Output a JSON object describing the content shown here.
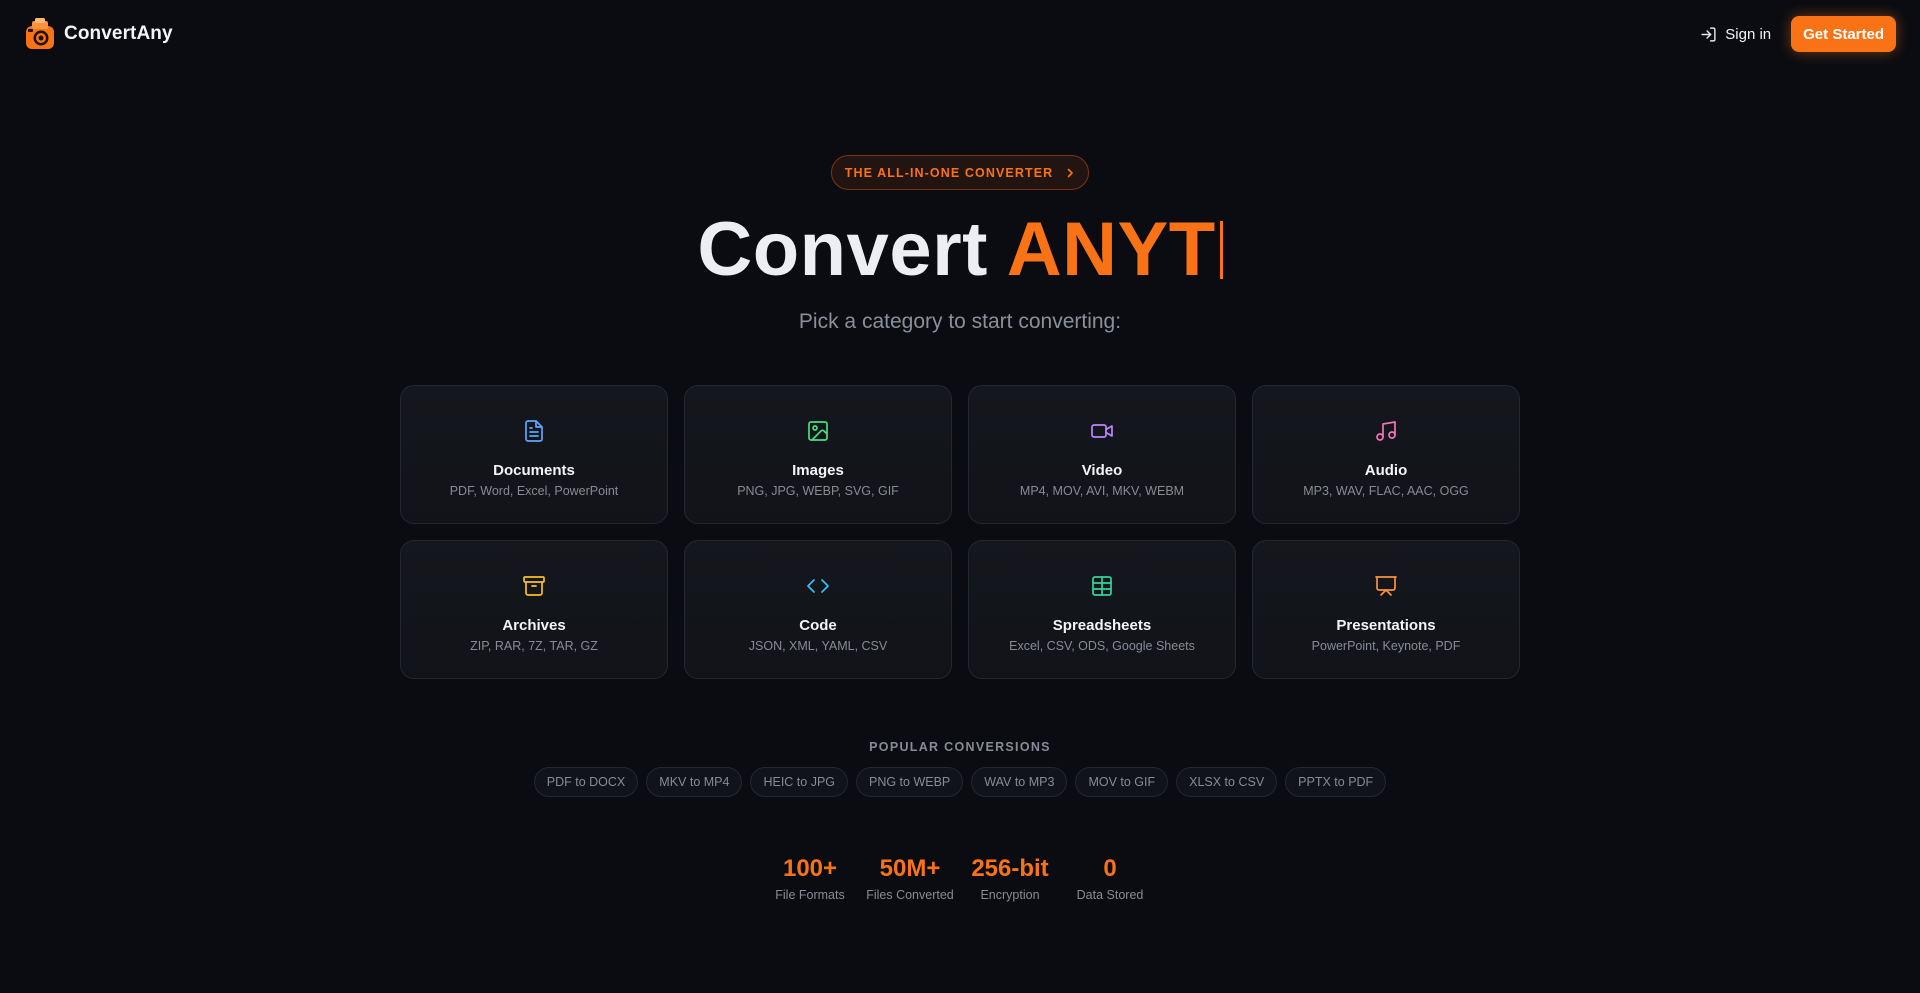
{
  "header": {
    "brand_name": "ConvertAny",
    "signin_label": "Sign in",
    "get_started_label": "Get Started"
  },
  "hero": {
    "pill_text": "THE ALL-IN-ONE CONVERTER",
    "title_prefix": "Convert",
    "title_accent": "ANYT",
    "subtitle": "Pick a category to start converting:"
  },
  "categories": [
    {
      "title": "Documents",
      "desc": "PDF, Word, Excel, PowerPoint",
      "icon": "document-icon",
      "color": "#60a5fa"
    },
    {
      "title": "Images",
      "desc": "PNG, JPG, WEBP, SVG, GIF",
      "icon": "image-icon",
      "color": "#4ade80"
    },
    {
      "title": "Video",
      "desc": "MP4, MOV, AVI, MKV, WEBM",
      "icon": "video-icon",
      "color": "#c084fc"
    },
    {
      "title": "Audio",
      "desc": "MP3, WAV, FLAC, AAC, OGG",
      "icon": "music-icon",
      "color": "#f472b6"
    },
    {
      "title": "Archives",
      "desc": "ZIP, RAR, 7Z, TAR, GZ",
      "icon": "archive-icon",
      "color": "#fbbf24"
    },
    {
      "title": "Code",
      "desc": "JSON, XML, YAML, CSV",
      "icon": "code-icon",
      "color": "#38bdf8"
    },
    {
      "title": "Spreadsheets",
      "desc": "Excel, CSV, ODS, Google Sheets",
      "icon": "table-icon",
      "color": "#34d399"
    },
    {
      "title": "Presentations",
      "desc": "PowerPoint, Keynote, PDF",
      "icon": "presentation-icon",
      "color": "#fb923c"
    }
  ],
  "popular": {
    "label": "POPULAR CONVERSIONS",
    "items": [
      "PDF to DOCX",
      "MKV to MP4",
      "HEIC to JPG",
      "PNG to WEBP",
      "WAV to MP3",
      "MOV to GIF",
      "XLSX to CSV",
      "PPTX to PDF"
    ]
  },
  "stats": [
    {
      "value": "100+",
      "label": "File Formats"
    },
    {
      "value": "50M+",
      "label": "Files Converted"
    },
    {
      "value": "256-bit",
      "label": "Encryption"
    },
    {
      "value": "0",
      "label": "Data Stored"
    }
  ],
  "colors": {
    "accent": "#f97316",
    "background": "#0a0c11",
    "card_border": "#23272f",
    "muted_text": "#868b97"
  }
}
